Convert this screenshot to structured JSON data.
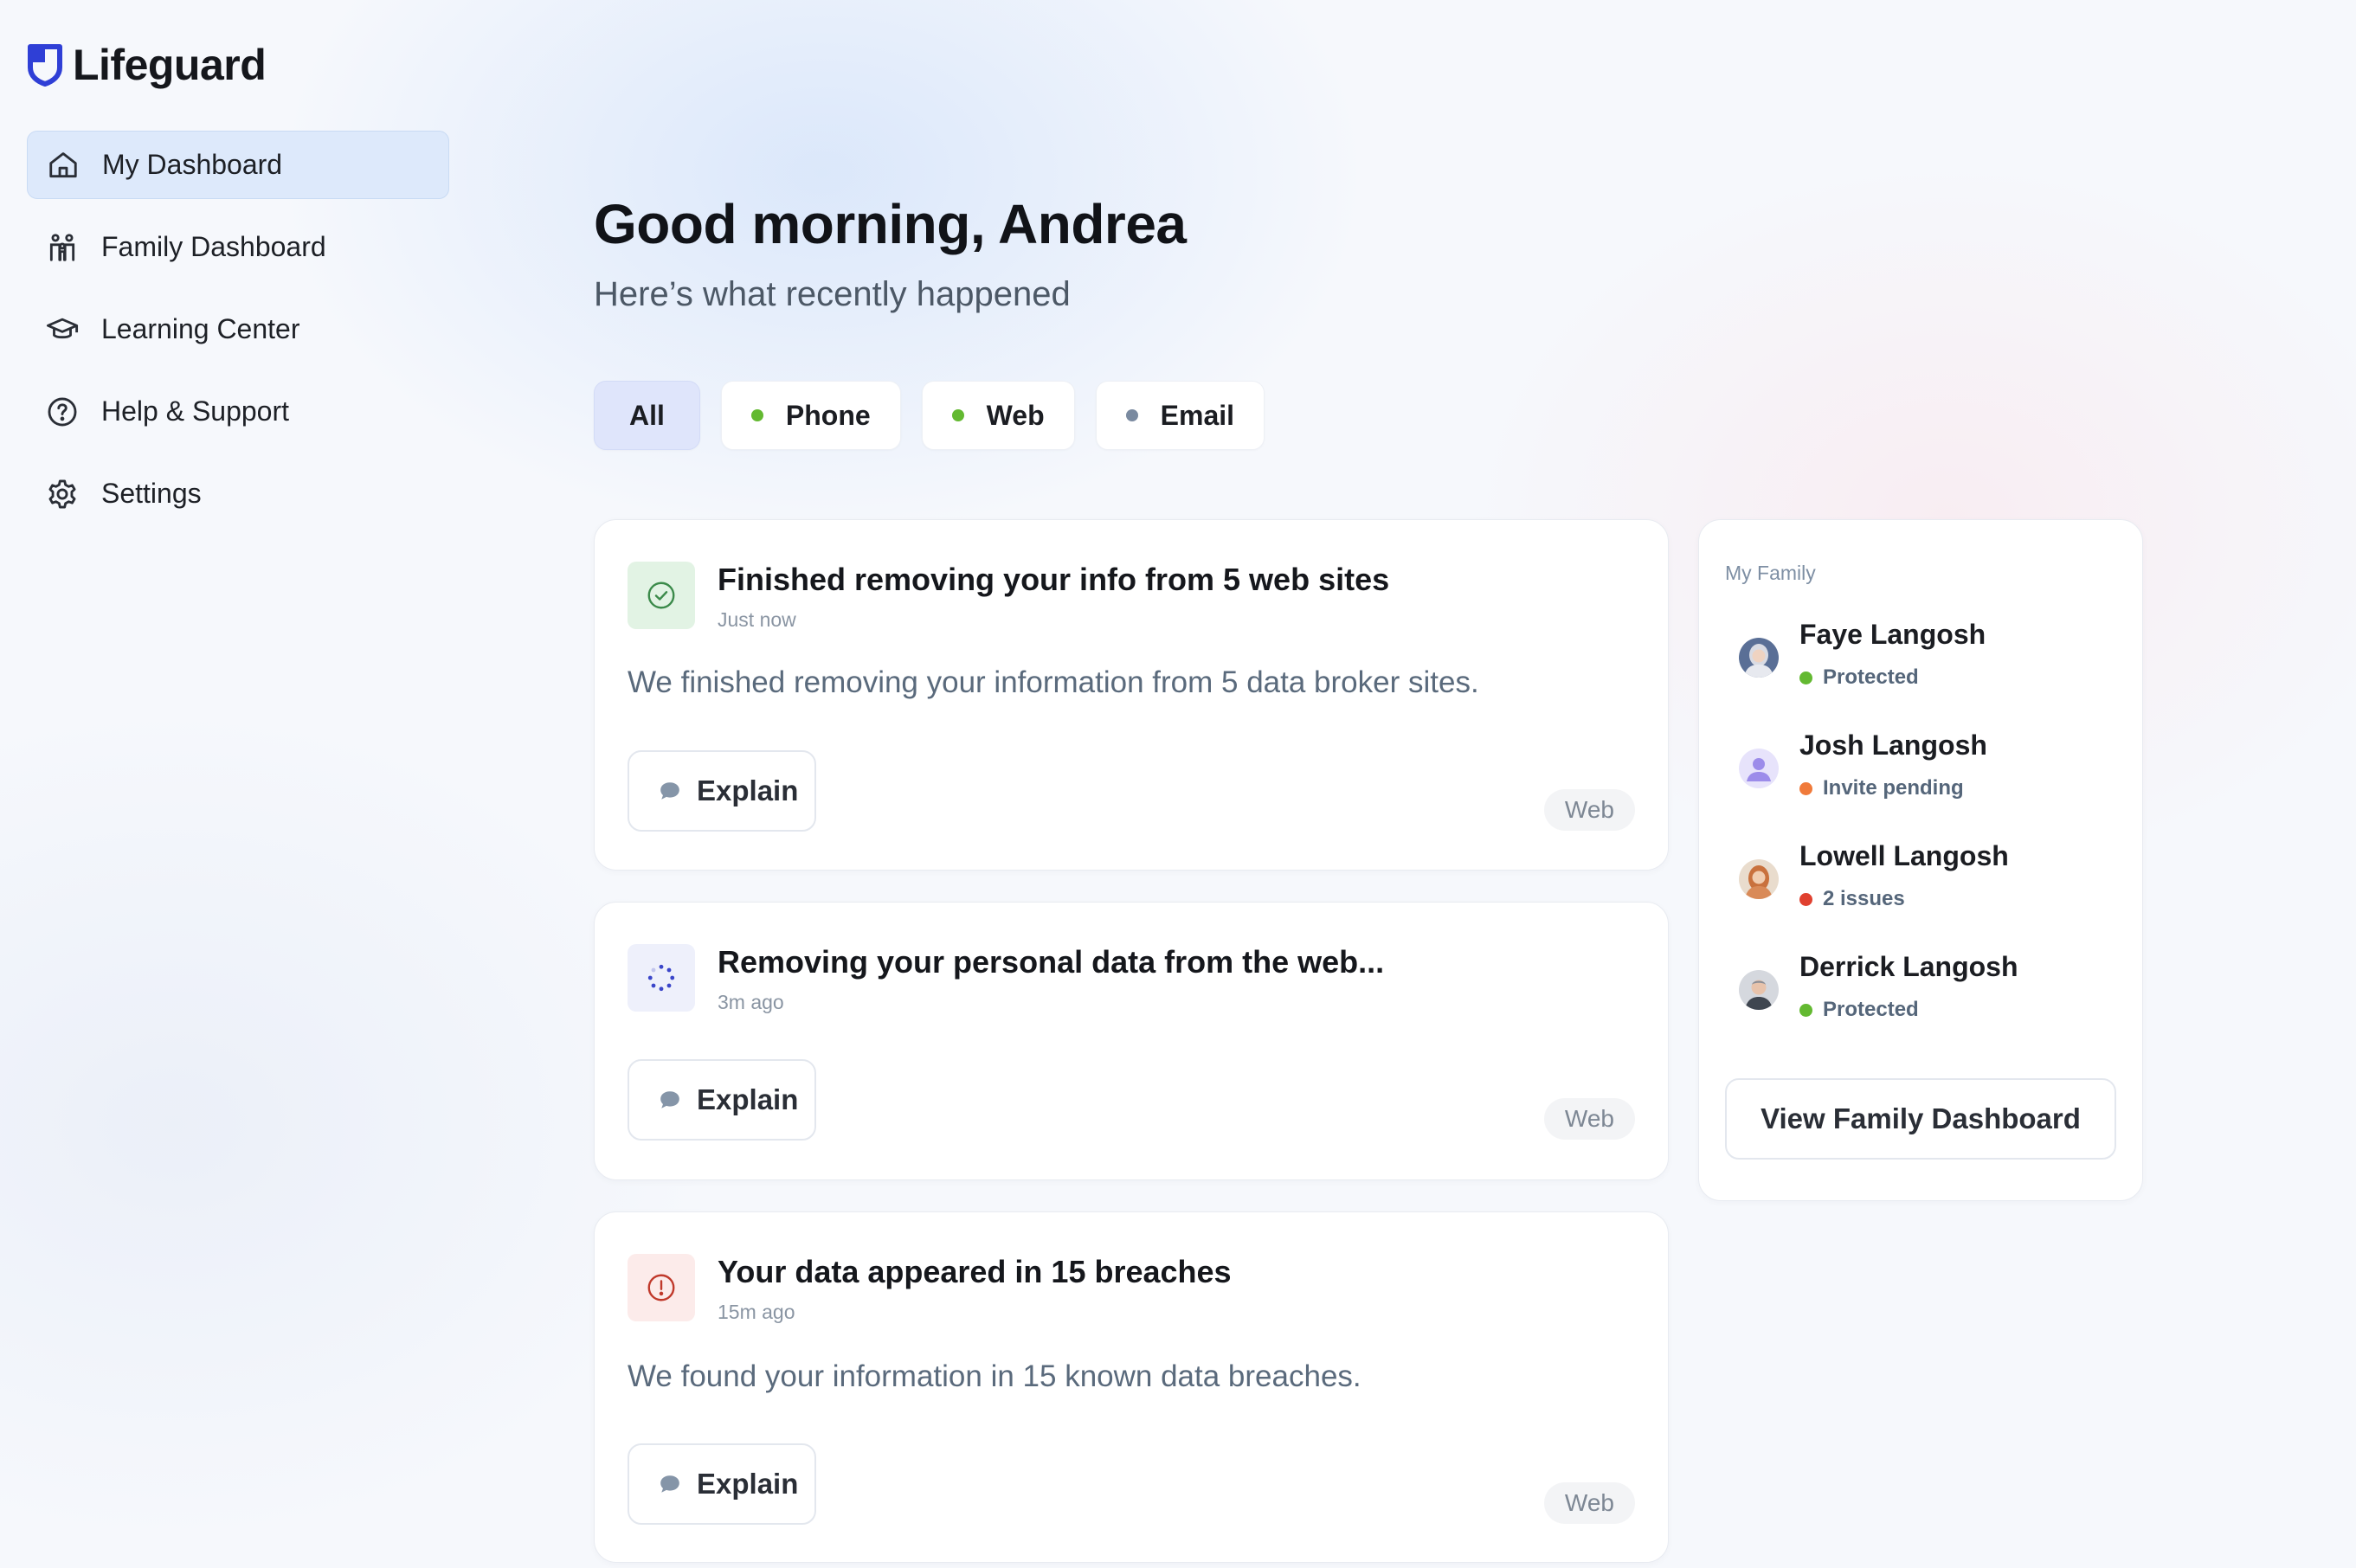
{
  "app": {
    "name": "Lifeguard",
    "brand_color": "#2f3fd6"
  },
  "sidebar": {
    "items": [
      {
        "label": "My Dashboard",
        "icon": "home-icon",
        "active": true
      },
      {
        "label": "Family Dashboard",
        "icon": "family-icon",
        "active": false
      },
      {
        "label": "Learning Center",
        "icon": "graduation-cap-icon",
        "active": false
      },
      {
        "label": "Help & Support",
        "icon": "help-circle-icon",
        "active": false
      },
      {
        "label": "Settings",
        "icon": "gear-icon",
        "active": false
      }
    ]
  },
  "header": {
    "greeting": "Good morning, Andrea",
    "subtitle": "Here’s what recently happened"
  },
  "filters": [
    {
      "label": "All",
      "active": true
    },
    {
      "label": "Phone",
      "dot_color": "#63b931"
    },
    {
      "label": "Web",
      "dot_color": "#63b931"
    },
    {
      "label": "Email",
      "dot_color": "#7a8aa0"
    }
  ],
  "activity": [
    {
      "title": "Finished removing your info from 5 web sites",
      "time": "Just now",
      "description": "We finished removing your information from 5 data broker sites.",
      "button": "Explain",
      "tag": "Web",
      "icon": "check-circle-icon",
      "icon_color": "#3b8a4a"
    },
    {
      "title": "Removing your personal data from the web...",
      "time": "3m ago",
      "button": "Explain",
      "tag": "Web",
      "icon": "spinner-icon",
      "icon_color": "#3a45c9"
    },
    {
      "title": "Your data appeared in 15 breaches",
      "time": "15m ago",
      "description": "We found your information in 15 known data breaches.",
      "button": "Explain",
      "tag": "Web",
      "icon": "alert-circle-icon",
      "icon_color": "#c0392b"
    }
  ],
  "family": {
    "label": "My Family",
    "members": [
      {
        "name": "Faye Langosh",
        "status": "Protected",
        "status_color": "#63b931",
        "avatar": "photo-avatar"
      },
      {
        "name": "Josh Langosh",
        "status": "Invite pending",
        "status_color": "#f07a3a",
        "avatar": "placeholder-avatar"
      },
      {
        "name": "Lowell Langosh",
        "status": "2 issues",
        "status_color": "#e0402f",
        "avatar": "photo-avatar"
      },
      {
        "name": "Derrick Langosh",
        "status": "Protected",
        "status_color": "#63b931",
        "avatar": "photo-avatar"
      }
    ],
    "button": "View Family Dashboard"
  }
}
